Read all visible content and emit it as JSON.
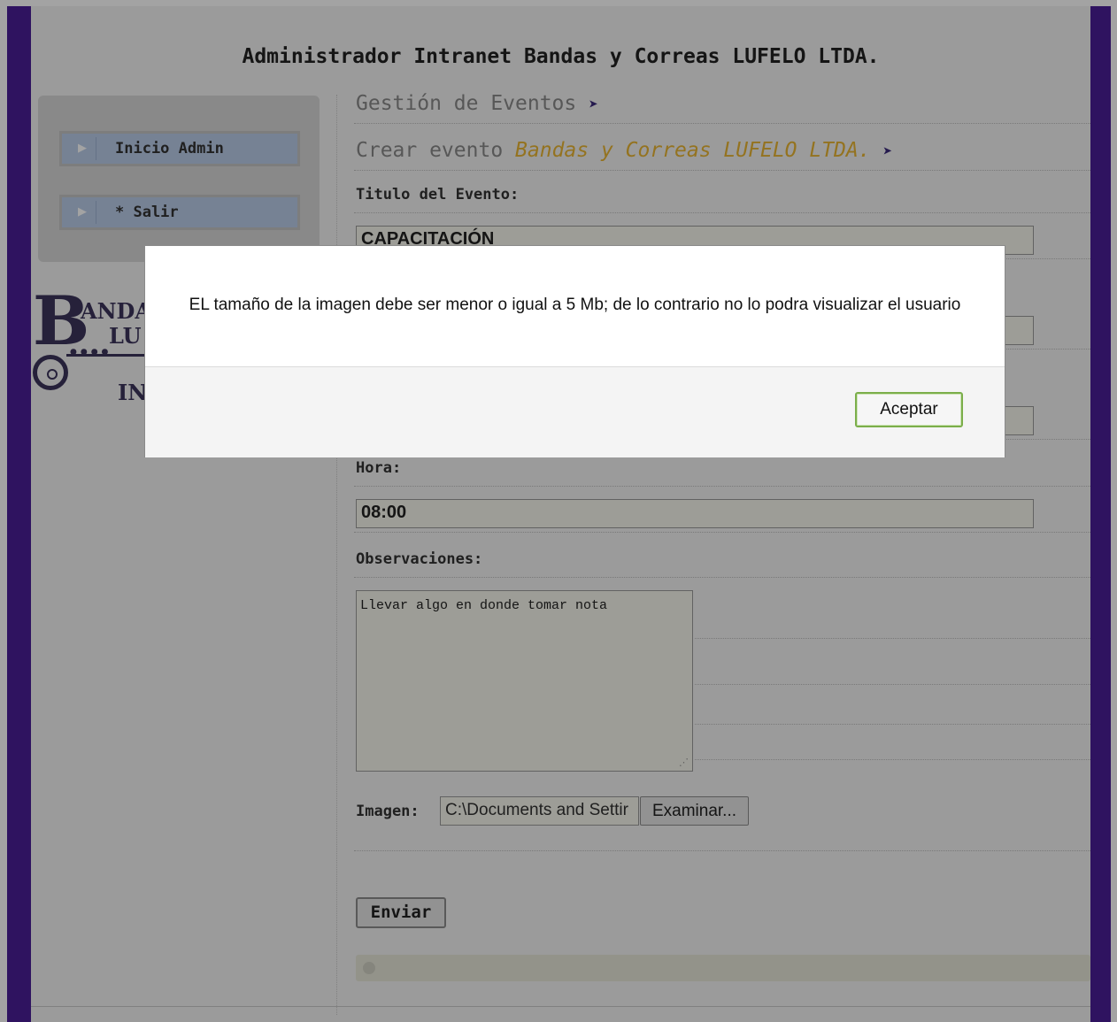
{
  "site": {
    "title": "Administrador Intranet Bandas y Correas LUFELO LTDA."
  },
  "sidebar": {
    "items": [
      {
        "label": "Inicio Admin"
      },
      {
        "label": "* Salir"
      }
    ],
    "logo": {
      "letter": "B",
      "line1": "ANDA",
      "line2": "LU",
      "line3": "IN"
    }
  },
  "main": {
    "section_title": "Gestión de Eventos",
    "sub_title": "Crear evento",
    "sub_title_accent": "Bandas y Correas LUFELO LTDA.",
    "form": {
      "titulo_label": "Titulo del Evento:",
      "titulo_value": "CAPACITACIÓN",
      "hora_label": "Hora:",
      "hora_value": "08:00",
      "observaciones_label": "Observaciones:",
      "observaciones_value": "Llevar algo en donde tomar nota",
      "imagen_label": "Imagen:",
      "imagen_value": "C:\\Documents and Settir",
      "browse_label": "Examinar...",
      "submit_label": "Enviar"
    }
  },
  "dialog": {
    "message": "EL tamaño de la imagen debe ser menor o igual a 5 Mb; de lo contrario no lo podra visualizar el usuario",
    "accept_label": "Aceptar"
  },
  "icons": {
    "nav_arrow": "play-arrow-icon",
    "section_arrow": "double-chevron-right-icon"
  },
  "colors": {
    "frame": "#4a1e96",
    "accent": "#e8b432",
    "nav_button": "#b9cbe8",
    "dialog_button_border": "#7bae4a"
  }
}
